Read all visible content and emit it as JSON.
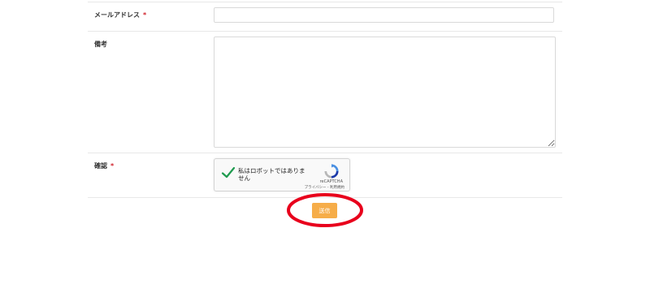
{
  "form": {
    "email": {
      "label": "メールアドレス",
      "required_mark": "*",
      "value": "",
      "placeholder": ""
    },
    "notes": {
      "label": "備考",
      "value": "",
      "placeholder": ""
    },
    "confirm": {
      "label": "確認",
      "required_mark": "*"
    },
    "recaptcha": {
      "checkbox_text": "私はロボットではありません",
      "checked": true,
      "brand": "reCAPTCHA",
      "terms": "プライバシー - 利用規約",
      "icon": "recaptcha-logo-icon"
    },
    "submit_label": "送信"
  },
  "colors": {
    "required": "#d0202a",
    "submit_bg": "#f6ad49",
    "checkmark": "#1f9b4f",
    "highlight": "#e8001c"
  },
  "annotation": {
    "type": "ellipse-highlight",
    "target": "submit-button"
  }
}
